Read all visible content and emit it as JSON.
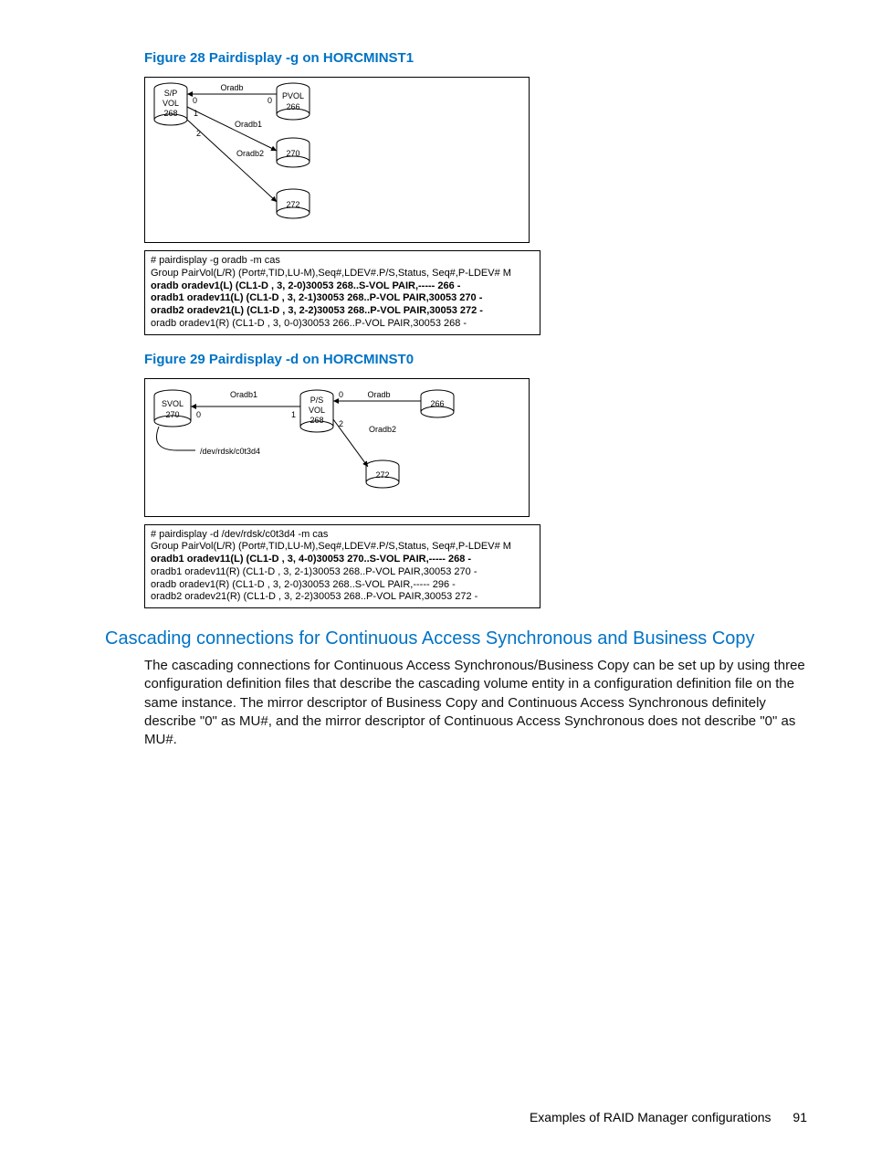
{
  "figure28": {
    "title": "Figure 28 Pairdisplay -g on HORCMINST1",
    "labels": {
      "spvol": "S/P\nVOL\n268",
      "pvol": "PVOL\n266",
      "v270": "270",
      "v272": "272",
      "oradb": "Oradb",
      "oradb1": "Oradb1",
      "oradb2": "Oradb2",
      "n0a": "0",
      "n0b": "0",
      "n1": "1",
      "n2": "2"
    },
    "table": {
      "cmd": "# pairdisplay -g oradb -m cas",
      "header": "Group   PairVol(L/R) (Port#,TID,LU-M),Seq#,LDEV#.P/S,Status, Seq#,P-LDEV# M",
      "rows": [
        {
          "bold": true,
          "text": "oradb   oradev1(L)  (CL1-D , 3,  2-0)30053  268..S-VOL PAIR,-----        266  -"
        },
        {
          "bold": true,
          "text": "oradb1 oradev11(L) (CL1-D , 3,  2-1)30053  268..P-VOL PAIR,30053    270  -"
        },
        {
          "bold": true,
          "text": "oradb2 oradev21(L) (CL1-D , 3,  2-2)30053  268..P-VOL PAIR,30053    272  -"
        },
        {
          "bold": false,
          "text": "oradb    oradev1(R)  (CL1-D , 3,  0-0)30053  266..P-VOL PAIR,30053    268  -"
        }
      ]
    }
  },
  "figure29": {
    "title": "Figure 29 Pairdisplay -d on HORCMINST0",
    "labels": {
      "svol": "SVOL\n270",
      "psvol": "P/S\nVOL\n268",
      "v266": "266",
      "v272": "272",
      "oradb": "Oradb",
      "oradb1": "Oradb1",
      "oradb2": "Oradb2",
      "dev": "/dev/rdsk/c0t3d4",
      "n0a": "0",
      "n0b": "0",
      "n1": "1",
      "n2": "2"
    },
    "table": {
      "cmd": "# pairdisplay -d /dev/rdsk/c0t3d4 -m cas",
      "header": "Group   PairVol(L/R) (Port#,TID,LU-M),Seq#,LDEV#.P/S,Status, Seq#,P-LDEV# M",
      "rows": [
        {
          "bold": true,
          "text": "oradb1  oradev11(L) (CL1-D , 3,  4-0)30053  270..S-VOL PAIR,-----        268  -"
        },
        {
          "bold": false,
          "text": "oradb1  oradev11(R) (CL1-D , 3,  2-1)30053  268..P-VOL  PAIR,30053    270  -"
        },
        {
          "bold": false,
          "text": "oradb   oradev1(R)   (CL1-D , 3,  2-0)30053  268..S-VOL  PAIR,-----       296  -"
        },
        {
          "bold": false,
          "text": "oradb2 oradev21(R) (CL1-D , 3,  2-2)30053  268..P-VOL  PAIR,30053    272  -"
        }
      ]
    }
  },
  "section": {
    "title": "Cascading connections for Continuous Access Synchronous and Business Copy",
    "body": "The cascading connections for Continuous Access Synchronous/Business Copy can be set up by using three configuration definition files that describe the cascading volume entity in a configuration definition file on the same instance. The mirror descriptor of Business Copy and Continuous Access Synchronous definitely describe \"0\" as MU#, and the mirror descriptor of Continuous Access Synchronous does not describe \"0\" as MU#."
  },
  "footer": {
    "text": "Examples of RAID Manager configurations",
    "page": "91"
  }
}
